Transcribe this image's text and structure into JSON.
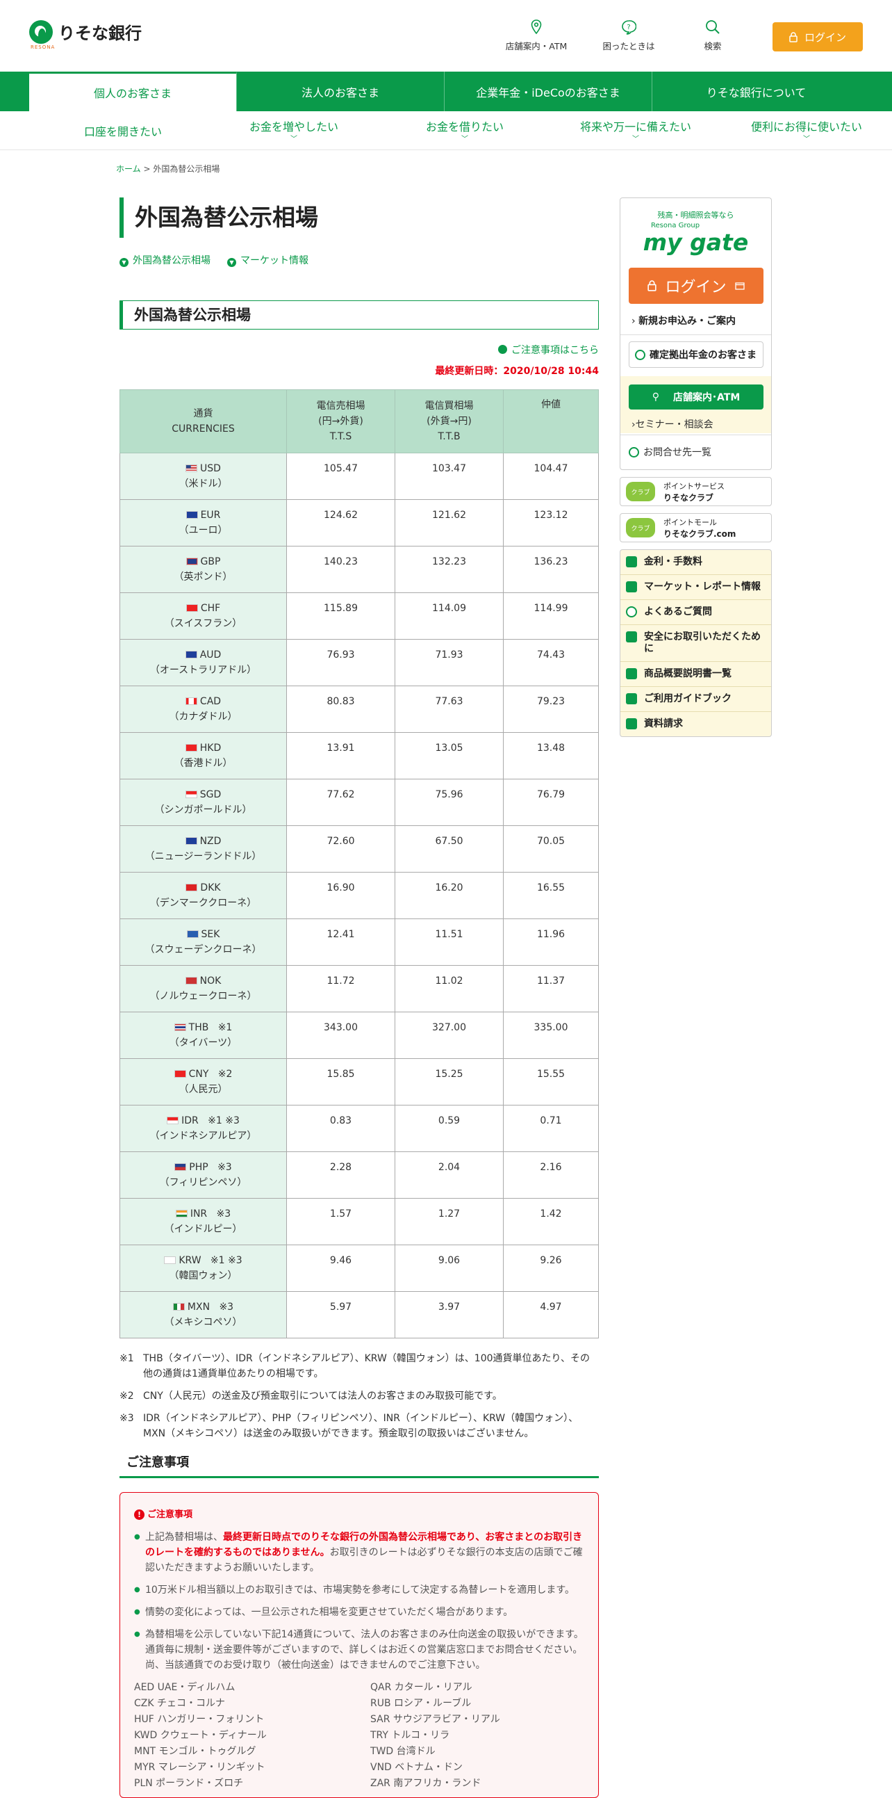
{
  "header": {
    "logo_text": "りそな銀行",
    "logo_sub": "RESONA",
    "nav": [
      {
        "label": "店舗案内・ATM",
        "icon": "map-pin-icon"
      },
      {
        "label": "困ったときは",
        "icon": "help-bubble-icon"
      },
      {
        "label": "検索",
        "icon": "search-icon"
      }
    ],
    "login_label": "ログイン"
  },
  "global_nav": [
    "個人のお客さま",
    "法人のお客さま",
    "企業年金・iDeCoのお客さま",
    "りそな銀行について"
  ],
  "sub_nav": [
    "口座を開きたい",
    "お金を増やしたい",
    "お金を借りたい",
    "将来や万一に備えたい",
    "便利にお得に使いたい"
  ],
  "breadcrumb": {
    "home": "ホーム",
    "separator": ">",
    "current": "外国為替公示相場"
  },
  "page": {
    "title": "外国為替公示相場",
    "anchors": [
      "外国為替公示相場",
      "マーケット情報"
    ],
    "section_title": "外国為替公示相場",
    "notes_link": "ご注意事項はこちら",
    "updated": "最終更新日時：2020/10/28 10:44"
  },
  "table": {
    "headers": [
      {
        "l1": "通貨",
        "l2": "CURRENCIES",
        "l3": ""
      },
      {
        "l1": "電信売相場",
        "l2": "(円→外貨)",
        "l3": "T.T.S"
      },
      {
        "l1": "電信買相場",
        "l2": "(外貨→円)",
        "l3": "T.T.B"
      },
      {
        "l1": "仲値",
        "l2": "",
        "l3": ""
      }
    ],
    "rows": [
      {
        "code": "USD",
        "note": "",
        "name": "（米ドル）",
        "tts": "105.47",
        "ttb": "103.47",
        "mid": "104.47",
        "flag": "us-flag-icon"
      },
      {
        "code": "EUR",
        "note": "",
        "name": "（ユーロ）",
        "tts": "124.62",
        "ttb": "121.62",
        "mid": "123.12",
        "flag": "eu-flag-icon"
      },
      {
        "code": "GBP",
        "note": "",
        "name": "（英ポンド）",
        "tts": "140.23",
        "ttb": "132.23",
        "mid": "136.23",
        "flag": "gb-flag-icon"
      },
      {
        "code": "CHF",
        "note": "",
        "name": "（スイスフラン）",
        "tts": "115.89",
        "ttb": "114.09",
        "mid": "114.99",
        "flag": "ch-flag-icon"
      },
      {
        "code": "AUD",
        "note": "",
        "name": "（オーストラリアドル）",
        "tts": "76.93",
        "ttb": "71.93",
        "mid": "74.43",
        "flag": "au-flag-icon"
      },
      {
        "code": "CAD",
        "note": "",
        "name": "（カナダドル）",
        "tts": "80.83",
        "ttb": "77.63",
        "mid": "79.23",
        "flag": "ca-flag-icon"
      },
      {
        "code": "HKD",
        "note": "",
        "name": "（香港ドル）",
        "tts": "13.91",
        "ttb": "13.05",
        "mid": "13.48",
        "flag": "hk-flag-icon"
      },
      {
        "code": "SGD",
        "note": "",
        "name": "（シンガポールドル）",
        "tts": "77.62",
        "ttb": "75.96",
        "mid": "76.79",
        "flag": "sg-flag-icon"
      },
      {
        "code": "NZD",
        "note": "",
        "name": "（ニュージーランドドル）",
        "tts": "72.60",
        "ttb": "67.50",
        "mid": "70.05",
        "flag": "nz-flag-icon"
      },
      {
        "code": "DKK",
        "note": "",
        "name": "（デンマーククローネ）",
        "tts": "16.90",
        "ttb": "16.20",
        "mid": "16.55",
        "flag": "dk-flag-icon"
      },
      {
        "code": "SEK",
        "note": "",
        "name": "（スウェーデンクローネ）",
        "tts": "12.41",
        "ttb": "11.51",
        "mid": "11.96",
        "flag": "se-flag-icon"
      },
      {
        "code": "NOK",
        "note": "",
        "name": "（ノルウェークローネ）",
        "tts": "11.72",
        "ttb": "11.02",
        "mid": "11.37",
        "flag": "no-flag-icon"
      },
      {
        "code": "THB",
        "note": "※1",
        "name": "（タイバーツ）",
        "tts": "343.00",
        "ttb": "327.00",
        "mid": "335.00",
        "flag": "th-flag-icon"
      },
      {
        "code": "CNY",
        "note": "※2",
        "name": "（人民元）",
        "tts": "15.85",
        "ttb": "15.25",
        "mid": "15.55",
        "flag": "cn-flag-icon"
      },
      {
        "code": "IDR",
        "note": "※1 ※3",
        "name": "（インドネシアルピア）",
        "tts": "0.83",
        "ttb": "0.59",
        "mid": "0.71",
        "flag": "id-flag-icon"
      },
      {
        "code": "PHP",
        "note": "※3",
        "name": "（フィリピンペソ）",
        "tts": "2.28",
        "ttb": "2.04",
        "mid": "2.16",
        "flag": "ph-flag-icon"
      },
      {
        "code": "INR",
        "note": "※3",
        "name": "（インドルピー）",
        "tts": "1.57",
        "ttb": "1.27",
        "mid": "1.42",
        "flag": "in-flag-icon"
      },
      {
        "code": "KRW",
        "note": "※1 ※3",
        "name": "（韓国ウォン）",
        "tts": "9.46",
        "ttb": "9.06",
        "mid": "9.26",
        "flag": "kr-flag-icon"
      },
      {
        "code": "MXN",
        "note": "※3",
        "name": "（メキシコペソ）",
        "tts": "5.97",
        "ttb": "3.97",
        "mid": "4.97",
        "flag": "mx-flag-icon"
      }
    ]
  },
  "footnotes": [
    {
      "mark": "※1",
      "text": "THB（タイバーツ）、IDR（インドネシアルピア）、KRW（韓国ウォン）は、100通貨単位あたり、その他の通貨は1通貨単位あたりの相場です。"
    },
    {
      "mark": "※2",
      "text": "CNY（人民元）の送金及び預金取引については法人のお客さまのみ取扱可能です。"
    },
    {
      "mark": "※3",
      "text": "IDR（インドネシアルピア）、PHP（フィリピンペソ）、INR（インドルピー）、KRW（韓国ウォン）、MXN（メキシコペソ）は送金のみ取扱いができます。預金取引の取扱いはございません。"
    }
  ],
  "caution": {
    "heading": "ご注意事項",
    "box_title": "ご注意事項",
    "items": [
      {
        "pre": "上記為替相場は、",
        "bold": "最終更新日時点でのりそな銀行の外国為替公示相場であり、お客さまとのお取引きのレートを確約するものではありません。",
        "post": "お取引きのレートは必ずりそな銀行の本支店の店頭でご確認いただきますようお願いいたします。"
      },
      {
        "pre": "10万米ドル相当額以上のお取引きでは、市場実勢を参考にして決定する為替レートを適用します。",
        "bold": "",
        "post": ""
      },
      {
        "pre": "情勢の変化によっては、一旦公示された相場を変更させていただく場合があります。",
        "bold": "",
        "post": ""
      },
      {
        "pre": "為替相場を公示していない下記14通貨について、法人のお客さまのみ仕向送金の取扱いができます。通貨毎に規制・送金要件等がございますので、詳しくはお近くの営業店窓口までお問合せください。尚、当該通貨でのお受け取り（被仕向送金）はできませんのでご注意下さい。",
        "bold": "",
        "post": ""
      }
    ],
    "currencies": [
      "AED UAE・ディルハム",
      "QAR カタール・リアル",
      "CZK チェコ・コルナ",
      "RUB ロシア・ルーブル",
      "HUF ハンガリー・フォリント",
      "SAR サウジアラビア・リアル",
      "KWD クウェート・ディナール",
      "TRY トルコ・リラ",
      "MNT モンゴル・トゥグルグ",
      "TWD 台湾ドル",
      "MYR マレーシア・リンギット",
      "VND ベトナム・ドン",
      "PLN ポーランド・ズロチ",
      "ZAR 南アフリカ・ランド"
    ]
  },
  "sidebar": {
    "mg_tagline": "残高・明細照会等なら",
    "mg_group": "Resona Group",
    "mg_brand": "my gate",
    "mg_login": "ログイン",
    "mg_new": "新規お申込み・ご案内",
    "mg_nenkin": "確定拠出年金のお客さま",
    "atm": "店舗案内･ATM",
    "seminar": "セミナー・相談会",
    "contact": "お問合せ先一覧",
    "club1_badge": "クラブ",
    "club1_sub": "ポイントサービス",
    "club1_name": "りそなクラブ",
    "club2_badge": "クラブ",
    "club2_sub": "ポイントモール",
    "club2_name": "りそなクラブ.com",
    "links": [
      {
        "label": "金利・手数料",
        "icon": "coins-icon"
      },
      {
        "label": "マーケット・レポート情報",
        "icon": "bar-chart-icon"
      },
      {
        "label": "よくあるご質問",
        "icon": "question-icon"
      },
      {
        "label": "安全にお取引いただくために",
        "icon": "shield-icon"
      },
      {
        "label": "商品概要説明書一覧",
        "icon": "document-icon"
      },
      {
        "label": "ご利用ガイドブック",
        "icon": "book-icon"
      },
      {
        "label": "資料請求",
        "icon": "document-icon"
      }
    ]
  },
  "colors": {
    "brand_green": "#0a9a4a",
    "login_orange": "#f3a21c",
    "mygate_orange": "#ee7330",
    "alert_red": "#e60012"
  }
}
